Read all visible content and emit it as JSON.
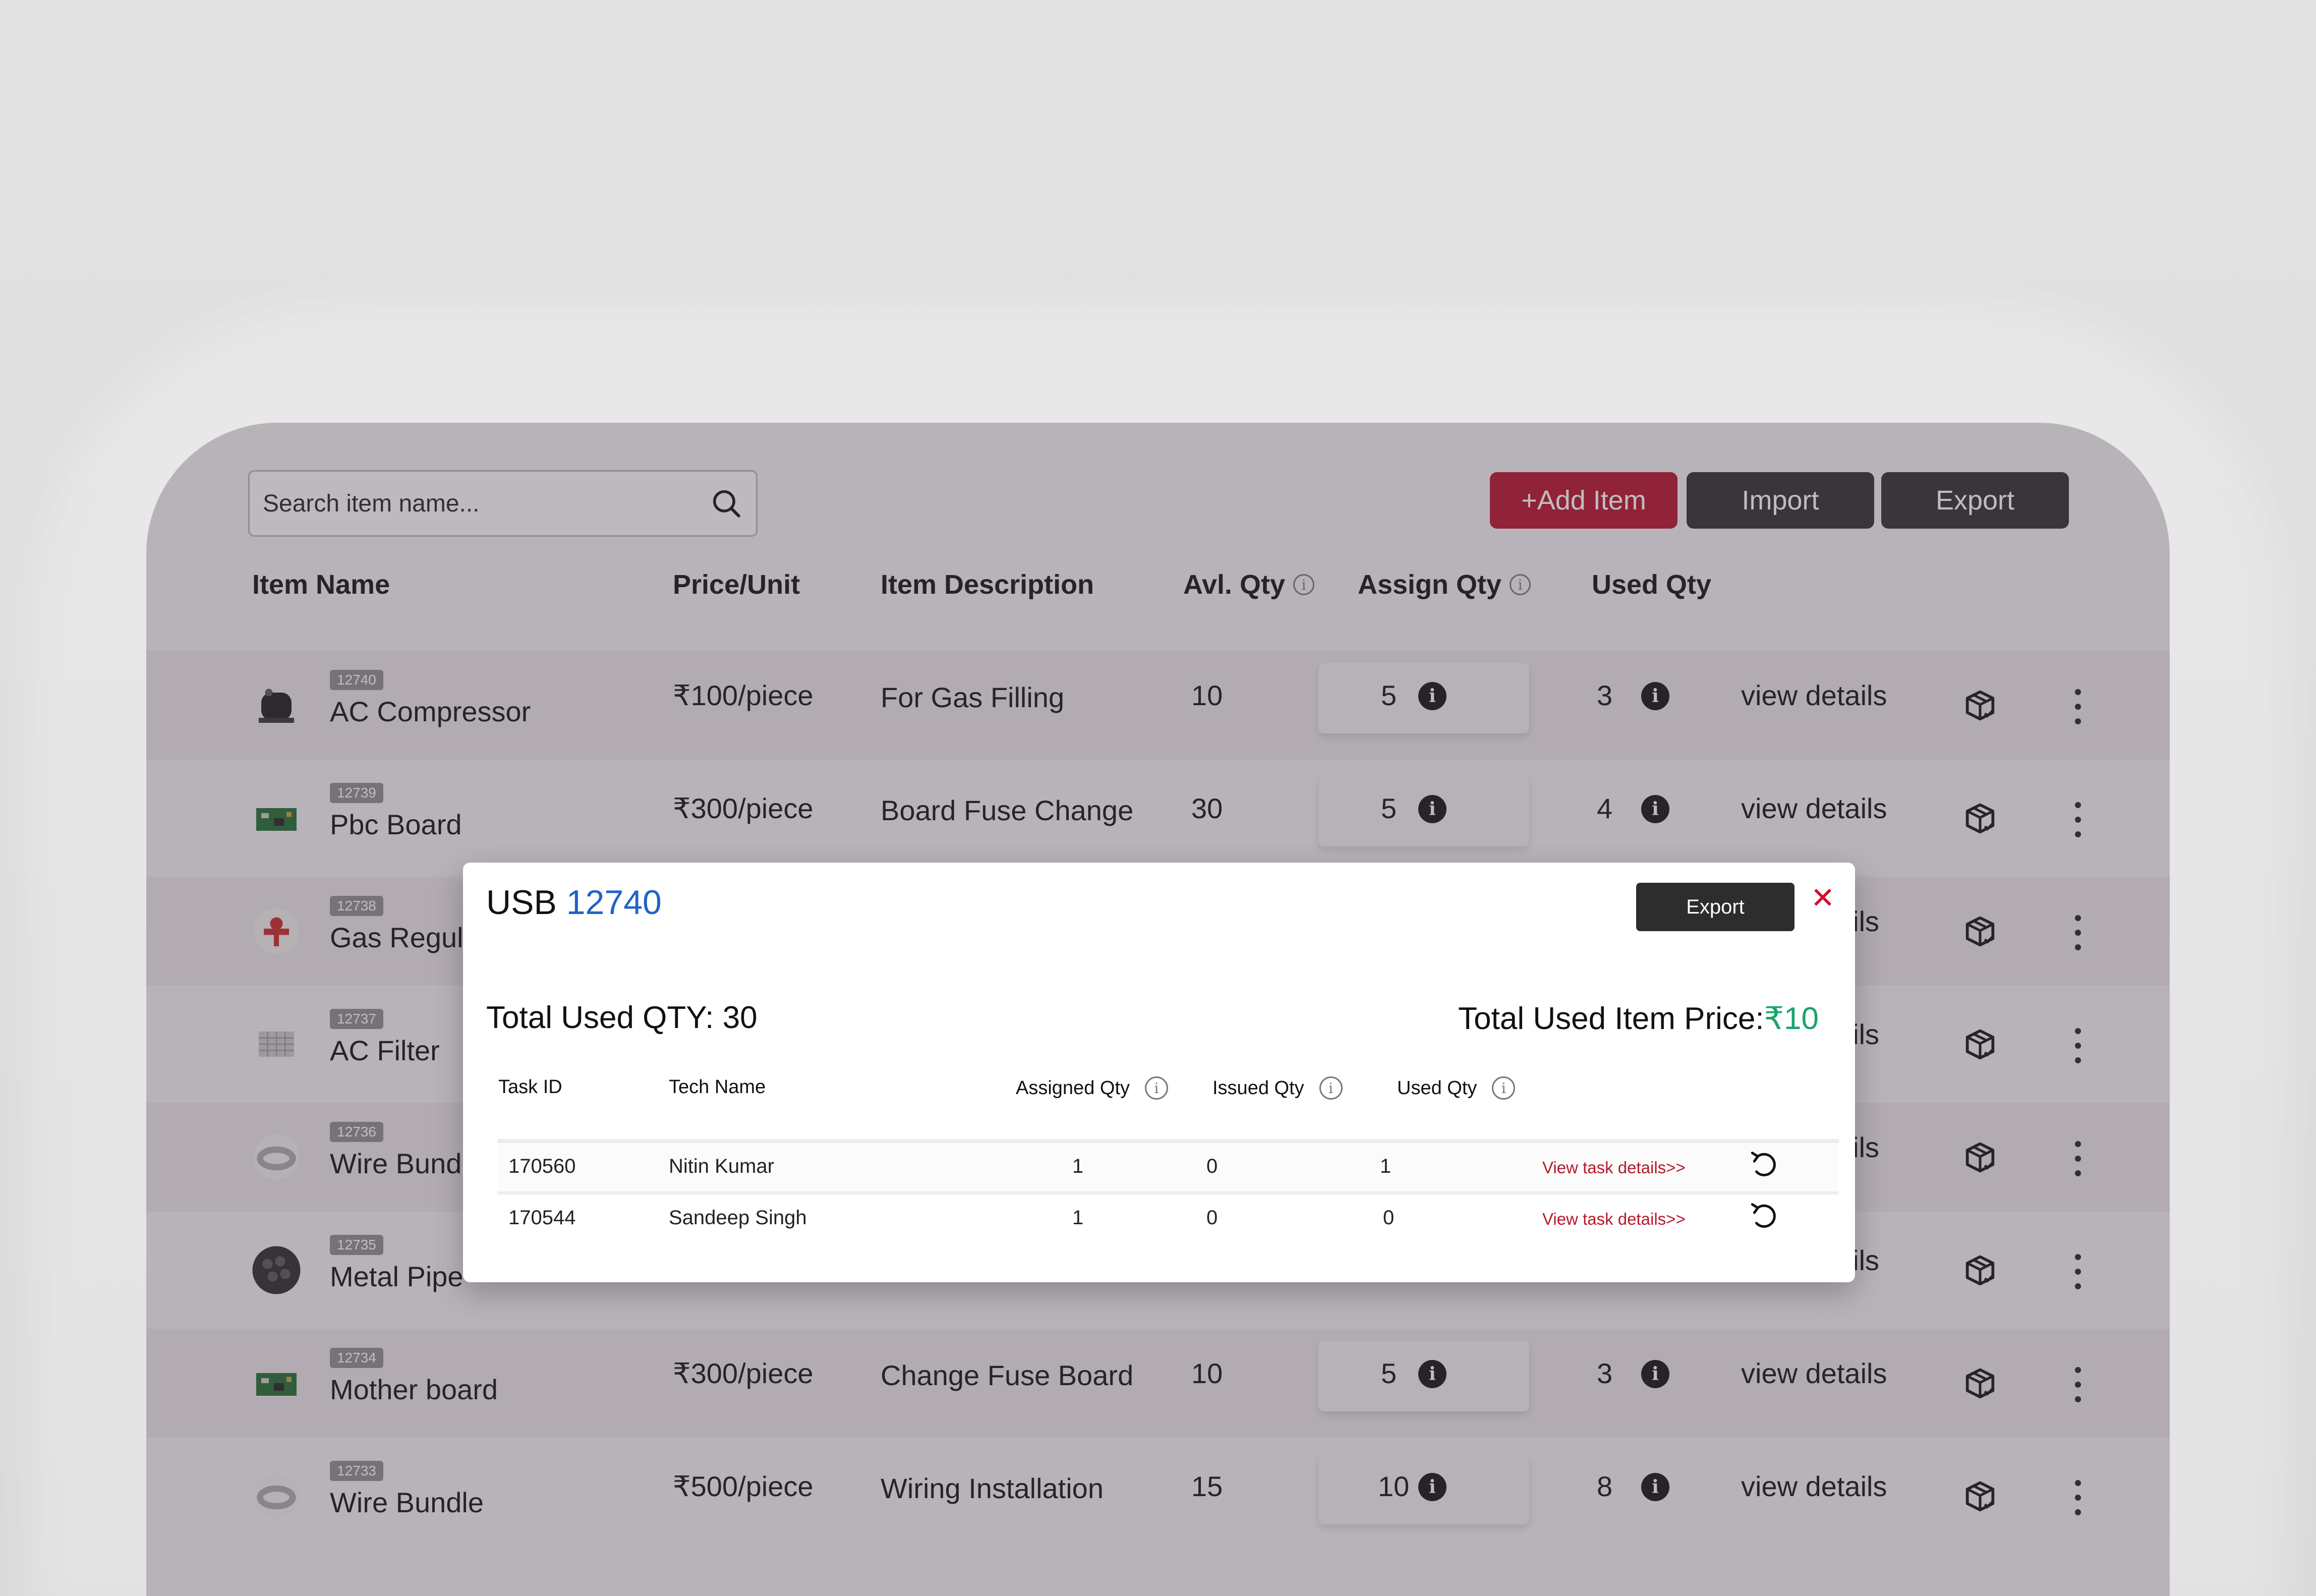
{
  "search": {
    "placeholder": "Search item name..."
  },
  "toolbar": {
    "add_label": "+Add Item",
    "import_label": "Import",
    "export_label": "Export"
  },
  "table": {
    "headers": {
      "item_name": "Item Name",
      "price": "Price/Unit",
      "description": "Item Description",
      "avl_qty": "Avl. Qty",
      "assign_qty": "Assign Qty",
      "used_qty": "Used Qty"
    },
    "rows": [
      {
        "id": "12740",
        "name": "AC Compressor",
        "price": "₹100/piece",
        "description": "For Gas Filling",
        "avl": "10",
        "assign": "5",
        "used": "3",
        "action": "view details",
        "thumb": "compressor-image"
      },
      {
        "id": "12739",
        "name": "Pbc Board",
        "price": "₹300/piece",
        "description": "Board Fuse Change",
        "avl": "30",
        "assign": "5",
        "used": "4",
        "action": "view details",
        "thumb": "circuit-board-image"
      },
      {
        "id": "12738",
        "name": "Gas Regul",
        "price": "",
        "description": "",
        "avl": "",
        "assign": "",
        "used": "",
        "action": "ails",
        "thumb": "gas-regulator-image"
      },
      {
        "id": "12737",
        "name": "AC Filter",
        "price": "",
        "description": "",
        "avl": "",
        "assign": "",
        "used": "",
        "action": "ails",
        "thumb": "filter-image"
      },
      {
        "id": "12736",
        "name": "Wire Bundl",
        "price": "",
        "description": "",
        "avl": "",
        "assign": "",
        "used": "",
        "action": "ails",
        "thumb": "wire-bundle-image"
      },
      {
        "id": "12735",
        "name": "Metal Pipe",
        "price": "",
        "description": "",
        "avl": "",
        "assign": "",
        "used": "",
        "action": "ails",
        "thumb": "metal-pipe-image"
      },
      {
        "id": "12734",
        "name": "Mother board",
        "price": "₹300/piece",
        "description": "Change Fuse Board",
        "avl": "10",
        "assign": "5",
        "used": "3",
        "action": "view details",
        "thumb": "circuit-board-image"
      },
      {
        "id": "12733",
        "name": "Wire Bundle",
        "price": "₹500/piece",
        "description": "Wiring Installation",
        "avl": "15",
        "assign": "10",
        "used": "8",
        "action": "view details",
        "thumb": "wire-bundle-image"
      }
    ]
  },
  "modal": {
    "title_prefix": "USB",
    "title_code": "12740",
    "export_label": "Export",
    "close_symbol": "✕",
    "total_qty_label": "Total Used QTY: 30",
    "total_price_label": "Total Used Item Price:",
    "total_price_value": "₹10",
    "columns": {
      "task_id": "Task ID",
      "tech_name": "Tech Name",
      "assigned": "Assigned Qty",
      "issued": "Issued Qty",
      "used": "Used Qty"
    },
    "rows": [
      {
        "task_id": "170560",
        "tech": "Nitin Kumar",
        "assigned": "1",
        "issued": "0",
        "used": "1",
        "link": "View task details>>"
      },
      {
        "task_id": "170544",
        "tech": "Sandeep Singh",
        "assigned": "1",
        "issued": "0",
        "used": "0",
        "link": "View task details>>"
      }
    ]
  },
  "colors": {
    "accent_red": "#b5102a",
    "dark_button": "#2d2d2d",
    "link_blue": "#1f63c7",
    "price_green": "#18a46c"
  }
}
